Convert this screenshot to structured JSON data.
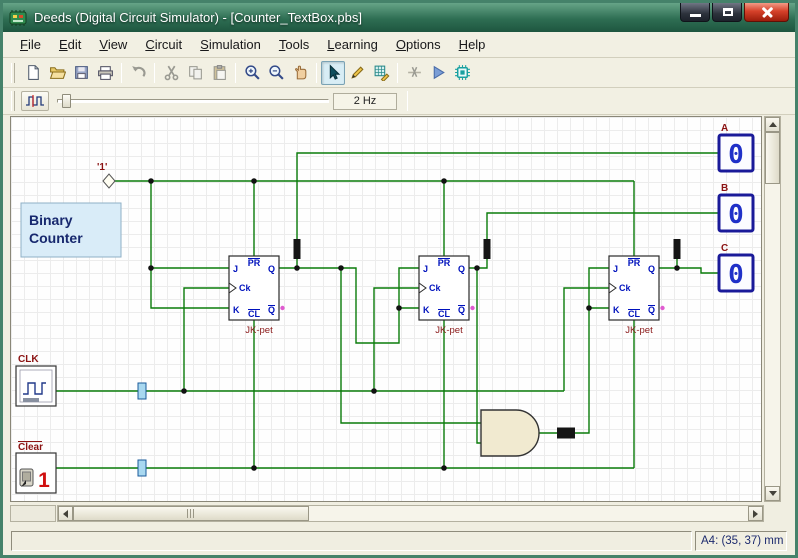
{
  "window": {
    "title": "Deeds (Digital Circuit Simulator) - [Counter_TextBox.pbs]",
    "controls": [
      "minimize",
      "maximize",
      "close"
    ]
  },
  "menu": {
    "items": [
      "File",
      "Edit",
      "View",
      "Circuit",
      "Simulation",
      "Tools",
      "Learning",
      "Options",
      "Help"
    ]
  },
  "toolbar": {
    "buttons": [
      "new-schematic",
      "open",
      "save",
      "print",
      "undo",
      "cut",
      "copy",
      "paste",
      "zoom-in",
      "zoom-out",
      "pan",
      "select-mode",
      "draw-wire",
      "edit-components",
      "wire-cutter",
      "run-simulation",
      "timing-diagram"
    ]
  },
  "clockbar": {
    "button": "clock-settings",
    "frequency": "2 Hz"
  },
  "circuit": {
    "note": {
      "line1": "Binary",
      "line2": "Counter"
    },
    "constant": {
      "label": "'1'"
    },
    "clock": {
      "label": "CLK"
    },
    "clear": {
      "label": "Clear",
      "value": "1"
    },
    "flipflop": {
      "type_label": "JK-pet",
      "pins": {
        "j": "J",
        "ck": "Ck",
        "k": "K",
        "pr": "PR",
        "cl": "CL",
        "q": "Q",
        "qn": "Q"
      }
    },
    "displays": [
      {
        "label": "A",
        "value": "0"
      },
      {
        "label": "B",
        "value": "0"
      },
      {
        "label": "C",
        "value": "0"
      }
    ]
  },
  "statusbar": {
    "position": "A4: (35, 37) mm"
  }
}
